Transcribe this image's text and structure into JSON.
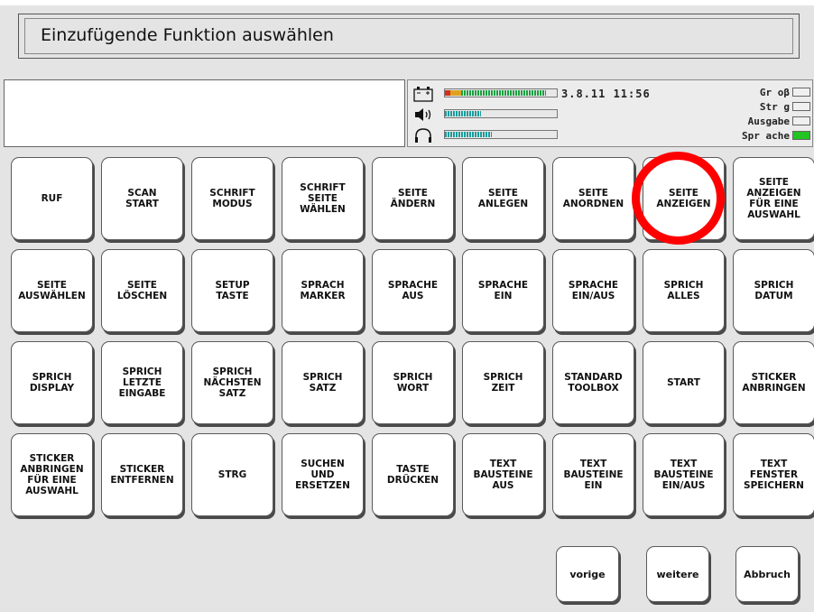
{
  "dialog": {
    "title": "Einzufügende Funktion auswählen"
  },
  "input_display": {
    "value": ""
  },
  "status": {
    "datetime": "3.8.11 11:56",
    "meters": [
      {
        "icon": "battery-icon",
        "level": 1.0
      },
      {
        "icon": "speaker-icon",
        "level": 0.33
      },
      {
        "icon": "headphones-icon",
        "level": 0.42
      }
    ],
    "indicators": [
      {
        "label": "Gr oβ",
        "on": false
      },
      {
        "label": "Str g",
        "on": false
      },
      {
        "label": "Ausgabe",
        "on": false
      },
      {
        "label": "Spr ache",
        "on": true
      }
    ]
  },
  "keys": [
    "RUF",
    "SCAN\nSTART",
    "SCHRIFT\nMODUS",
    "SCHRIFT\nSEITE\nWÄHLEN",
    "SEITE\nÄNDERN",
    "SEITE\nANLEGEN",
    "SEITE\nANORDNEN",
    "SEITE\nANZEIGEN",
    "SEITE\nANZEIGEN\nFÜR EINE\nAUSWAHL",
    "SEITE\nAUSWÄHLEN",
    "SEITE\nLÖSCHEN",
    "SETUP\nTASTE",
    "SPRACH\nMARKER",
    "SPRACHE\nAUS",
    "SPRACHE\nEIN",
    "SPRACHE\nEIN/AUS",
    "SPRICH\nALLES",
    "SPRICH\nDATUM",
    "SPRICH\nDISPLAY",
    "SPRICH\nLETZTE\nEINGABE",
    "SPRICH\nNÄCHSTEN\nSATZ",
    "SPRICH\nSATZ",
    "SPRICH\nWORT",
    "SPRICH\nZEIT",
    "STANDARD\nTOOLBOX",
    "START",
    "STICKER\nANBRINGEN",
    "STICKER\nANBRINGEN\nFÜR EINE\nAUSWAHL",
    "STICKER\nENTFERNEN",
    "STRG",
    "SUCHEN\nUND\nERSETZEN",
    "TASTE\nDRÜCKEN",
    "TEXT\nBAUSTEINE\nAUS",
    "TEXT\nBAUSTEINE\nEIN",
    "TEXT\nBAUSTEINE\nEIN/AUS",
    "TEXT\nFENSTER\nSPEICHERN"
  ],
  "nav": {
    "previous": "vorige",
    "next": "weitere",
    "cancel": "Abbruch"
  },
  "annotation": {
    "highlight_color": "#ff0000",
    "highlighted_key": "SEITE\nANZEIGEN"
  }
}
